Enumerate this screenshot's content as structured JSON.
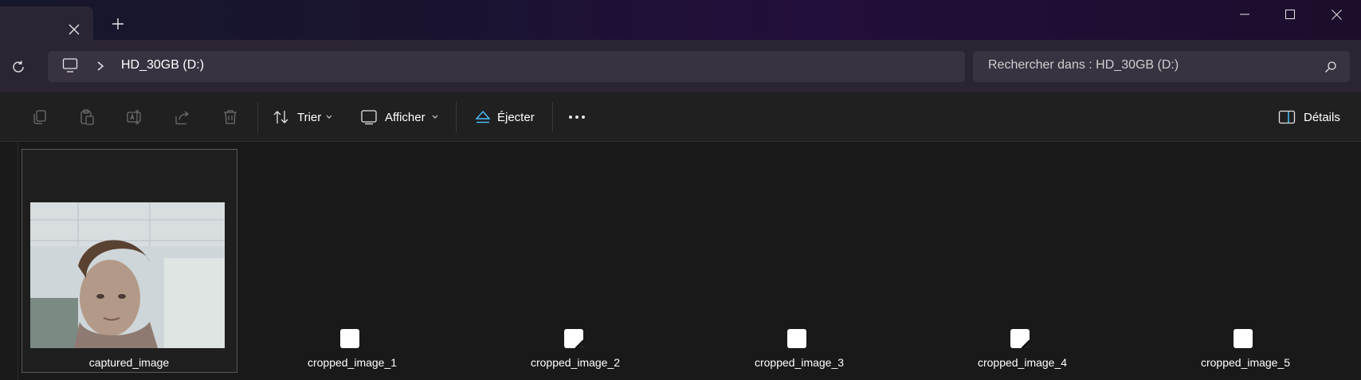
{
  "titlebar": {
    "tab_close_icon": "close-icon",
    "new_tab_icon": "plus-icon",
    "window_controls": [
      "minimize-icon",
      "maximize-icon",
      "close-icon"
    ]
  },
  "address": {
    "location": "HD_30GB (D:)",
    "search_placeholder": "Rechercher dans : HD_30GB (D:)"
  },
  "toolbar": {
    "sort_label": "Trier",
    "view_label": "Afficher",
    "eject_label": "Éjecter",
    "details_label": "Détails"
  },
  "files": [
    {
      "name": "captured_image",
      "type": "photo"
    },
    {
      "name": "cropped_image_1",
      "type": "blank"
    },
    {
      "name": "cropped_image_2",
      "type": "folded"
    },
    {
      "name": "cropped_image_3",
      "type": "blank"
    },
    {
      "name": "cropped_image_4",
      "type": "folded"
    },
    {
      "name": "cropped_image_5",
      "type": "blank"
    }
  ],
  "colors": {
    "accent": "#4cc2ff",
    "background": "#191919",
    "toolbar": "#202020",
    "address_bar": "#2b2433"
  }
}
